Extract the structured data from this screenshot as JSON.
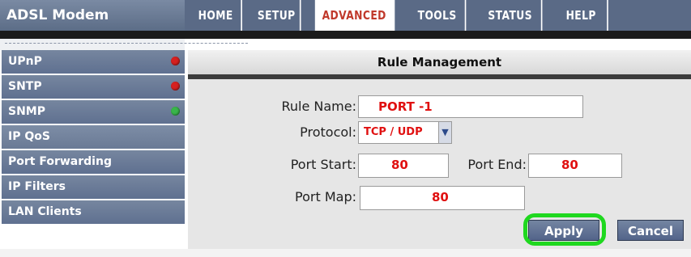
{
  "brand": "ADSL Modem",
  "nav": {
    "tabs": [
      {
        "label": "HOME",
        "active": false
      },
      {
        "label": "SETUP",
        "active": false
      },
      {
        "label": "ADVANCED",
        "active": true
      },
      {
        "label": "TOOLS",
        "active": false
      },
      {
        "label": "STATUS",
        "active": false
      },
      {
        "label": "HELP",
        "active": false
      }
    ]
  },
  "sidebar": {
    "items": [
      {
        "label": "UPnP",
        "status": "red"
      },
      {
        "label": "SNTP",
        "status": "red"
      },
      {
        "label": "SNMP",
        "status": "green"
      },
      {
        "label": "IP QoS",
        "status": ""
      },
      {
        "label": "Port Forwarding",
        "status": ""
      },
      {
        "label": "IP Filters",
        "status": ""
      },
      {
        "label": "LAN Clients",
        "status": ""
      }
    ]
  },
  "main": {
    "title": "Rule Management",
    "form": {
      "rule_name_label": "Rule Name:",
      "rule_name_value": "PORT -1",
      "protocol_label": "Protocol:",
      "protocol_value": "TCP / UDP",
      "port_start_label": "Port Start:",
      "port_start_value": "80",
      "port_end_label": "Port End:",
      "port_end_value": "80",
      "port_map_label": "Port Map:",
      "port_map_value": "80"
    },
    "buttons": {
      "apply": "Apply",
      "cancel": "Cancel"
    }
  },
  "colors": {
    "nav_bg": "#5a6a86",
    "active_tab_text": "#c0392b",
    "field_text": "#e01010",
    "highlight": "#1fd81f"
  }
}
